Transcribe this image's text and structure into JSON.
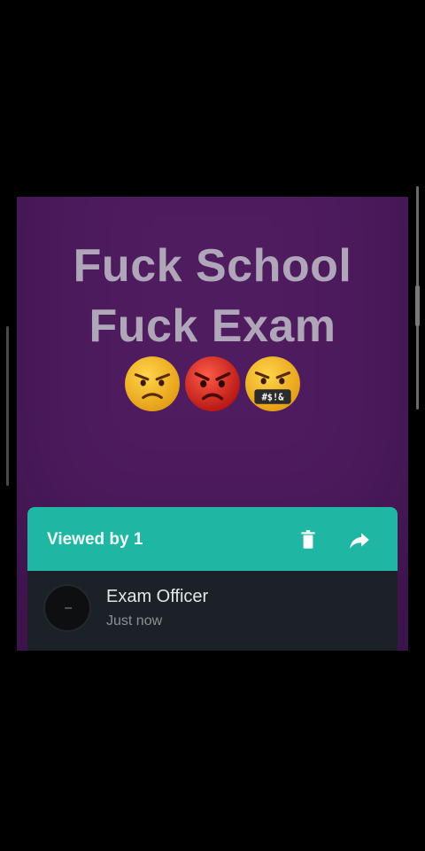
{
  "status": {
    "lines": [
      "Fuck School",
      "Fuck Exam"
    ],
    "background": "#4f1c5f",
    "text_color": "#b0a6b9",
    "emoji_names": [
      "unamused-angry-face",
      "pouting-red-face",
      "face-with-symbols-on-mouth"
    ],
    "emoji_mouth_text": "#$!&"
  },
  "viewers_panel": {
    "title": "Viewed by 1",
    "header_color": "#1fb6a3",
    "icons": [
      "delete-icon",
      "share-forward-icon"
    ],
    "viewers": [
      {
        "name": "Exam Officer",
        "time": "Just now"
      }
    ]
  }
}
